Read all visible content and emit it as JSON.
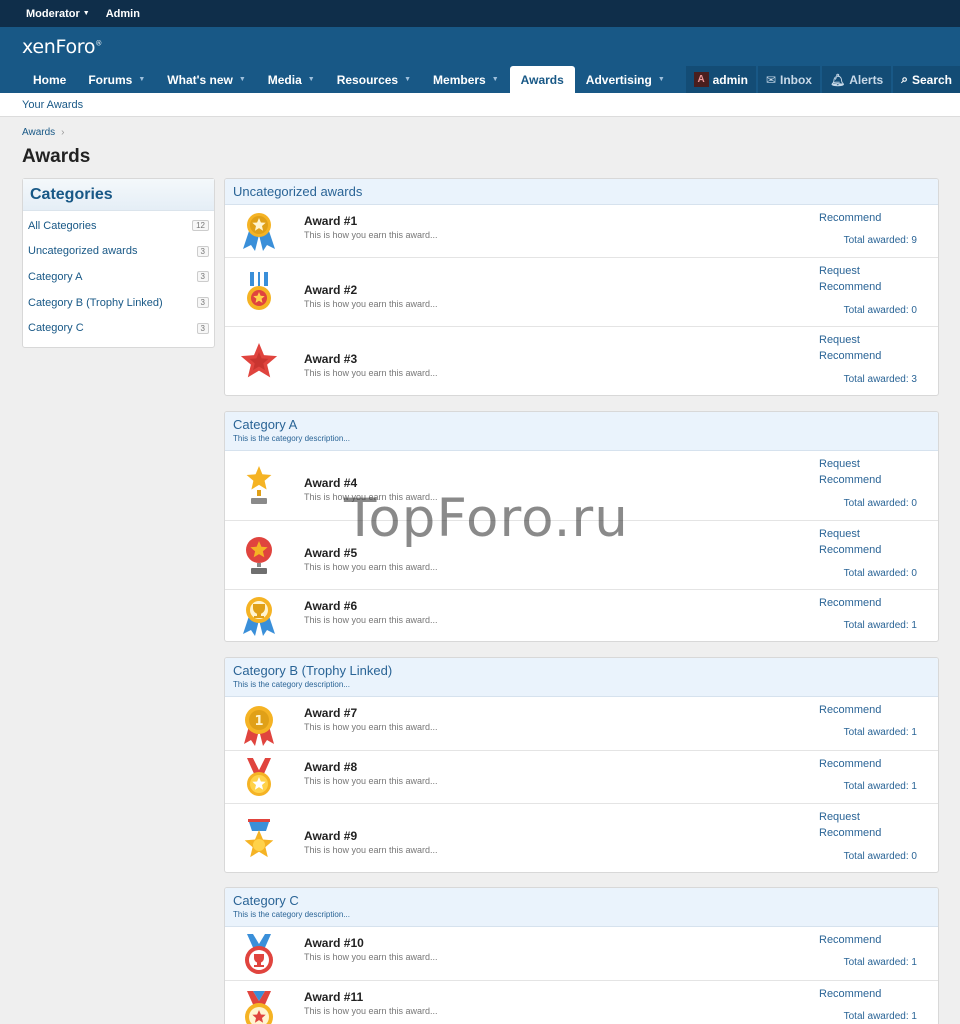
{
  "topbar": {
    "moderator": "Moderator",
    "admin": "Admin"
  },
  "logo": "xenForo",
  "nav": {
    "tabs": [
      {
        "label": "Home",
        "caret": false
      },
      {
        "label": "Forums",
        "caret": true
      },
      {
        "label": "What's new",
        "caret": true
      },
      {
        "label": "Media",
        "caret": true
      },
      {
        "label": "Resources",
        "caret": true
      },
      {
        "label": "Members",
        "caret": true
      },
      {
        "label": "Awards",
        "caret": false,
        "active": true
      },
      {
        "label": "Advertising",
        "caret": true
      }
    ],
    "user": "admin",
    "avatar_letter": "A",
    "inbox": "Inbox",
    "alerts": "Alerts",
    "search": "Search"
  },
  "subnav": {
    "your_awards": "Your Awards"
  },
  "breadcrumb": {
    "awards": "Awards",
    "sep": "›"
  },
  "page_title": "Awards",
  "sidebar": {
    "title": "Categories",
    "items": [
      {
        "label": "All Categories",
        "count": "12"
      },
      {
        "label": "Uncategorized awards",
        "count": "3"
      },
      {
        "label": "Category A",
        "count": "3"
      },
      {
        "label": "Category B (Trophy Linked)",
        "count": "3"
      },
      {
        "label": "Category C",
        "count": "3"
      }
    ]
  },
  "award_desc": "This is how you earn this award...",
  "category_desc": "This is the category description...",
  "labels": {
    "request": "Request",
    "recommend": "Recommend",
    "total": "Total awarded:"
  },
  "blocks": [
    {
      "title": "Uncategorized awards",
      "awards": [
        {
          "name": "Award #1",
          "request": false,
          "total": "9",
          "icon": "medal-star-ribbon-icon"
        },
        {
          "name": "Award #2",
          "request": true,
          "total": "0",
          "icon": "medal-striped-icon"
        },
        {
          "name": "Award #3",
          "request": true,
          "total": "3",
          "icon": "red-star-icon"
        }
      ]
    },
    {
      "title": "Category A",
      "awards": [
        {
          "name": "Award #4",
          "request": true,
          "total": "0",
          "icon": "star-trophy-icon"
        },
        {
          "name": "Award #5",
          "request": true,
          "total": "0",
          "icon": "star-badge-trophy-icon"
        },
        {
          "name": "Award #6",
          "request": false,
          "total": "1",
          "icon": "cup-medal-icon"
        }
      ]
    },
    {
      "title": "Category B (Trophy Linked)",
      "awards": [
        {
          "name": "Award #7",
          "request": false,
          "total": "1",
          "icon": "first-place-medal-icon"
        },
        {
          "name": "Award #8",
          "request": false,
          "total": "1",
          "icon": "gold-star-medal-icon"
        },
        {
          "name": "Award #9",
          "request": true,
          "total": "0",
          "icon": "blue-ribbon-medal-icon"
        }
      ]
    },
    {
      "title": "Category C",
      "awards": [
        {
          "name": "Award #10",
          "request": false,
          "total": "1",
          "icon": "cup-ribbon-medal-icon"
        },
        {
          "name": "Award #11",
          "request": false,
          "total": "1",
          "icon": "star-ribbon-medal-icon"
        }
      ]
    }
  ],
  "watermark": "TopForo.ru"
}
